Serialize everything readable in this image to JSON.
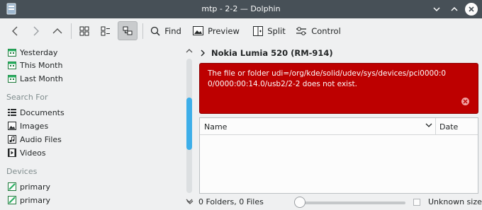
{
  "window": {
    "title": "mtp - 2-2 — Dolphin"
  },
  "toolbar": {
    "find": "Find",
    "preview": "Preview",
    "split": "Split",
    "control": "Control"
  },
  "sidebar": {
    "recent": [
      {
        "label": "Yesterday",
        "icon": "calendar-icon"
      },
      {
        "label": "This Month",
        "icon": "calendar-icon"
      },
      {
        "label": "Last Month",
        "icon": "calendar-icon"
      }
    ],
    "search_header": "Search For",
    "search": [
      {
        "label": "Documents",
        "icon": "documents-icon"
      },
      {
        "label": "Images",
        "icon": "images-icon"
      },
      {
        "label": "Audio Files",
        "icon": "audio-icon"
      },
      {
        "label": "Videos",
        "icon": "videos-icon"
      }
    ],
    "devices_header": "Devices",
    "devices": [
      {
        "label": "primary",
        "icon": "drive-icon"
      },
      {
        "label": "primary",
        "icon": "drive-icon"
      }
    ]
  },
  "breadcrumb": {
    "location": "Nokia Lumia 520 (RM-914)"
  },
  "error": {
    "message": "The file or folder udi=/org/kde/solid/udev/sys/devices/pci0000:00/0000:00:14.0/usb2/2-2 does not exist."
  },
  "list": {
    "columns": {
      "name": "Name",
      "date": "Date"
    }
  },
  "status": {
    "summary": "0 Folders, 0 Files",
    "size": "Unknown size",
    "zoom_level": 0
  },
  "colors": {
    "accent": "#3daee9",
    "error": "#bd0000",
    "titlebar": "#475057"
  }
}
